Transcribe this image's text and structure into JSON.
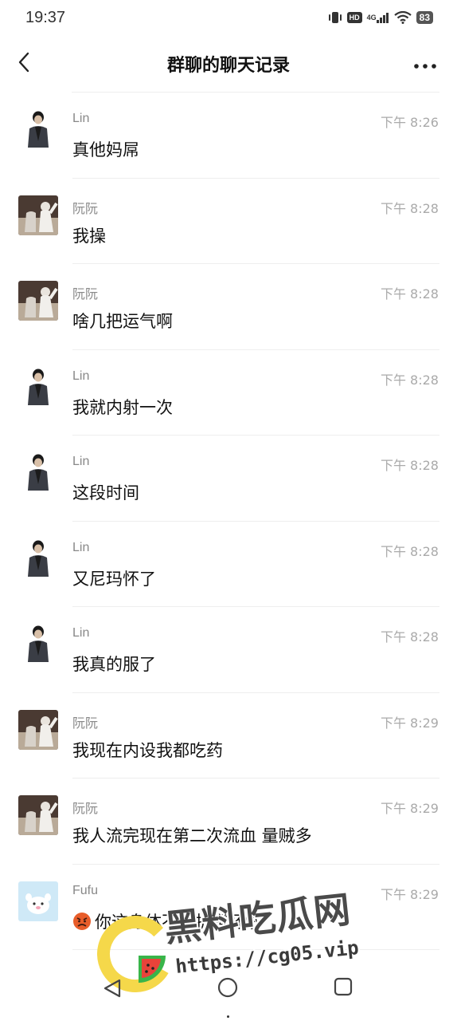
{
  "status_bar": {
    "time": "19:37",
    "hd_label": "HD",
    "network_label": "4G",
    "battery": "83",
    "icons": [
      "vibrate-icon",
      "hd-icon",
      "signal-icon",
      "wifi-icon",
      "battery-icon"
    ]
  },
  "header": {
    "title": "群聊的聊天记录",
    "back_icon": "chevron-left-icon",
    "more_icon": "more-horizontal-icon"
  },
  "messages": [
    {
      "sender": "Lin",
      "time": "下午 8:26",
      "text": "真他妈屌",
      "avatar": "lin"
    },
    {
      "sender": "阮阮",
      "time": "下午 8:28",
      "text": "我操",
      "avatar": "ruanruan"
    },
    {
      "sender": "阮阮",
      "time": "下午 8:28",
      "text": "啥几把运气啊",
      "avatar": "ruanruan"
    },
    {
      "sender": "Lin",
      "time": "下午 8:28",
      "text": "我就内射一次",
      "avatar": "lin"
    },
    {
      "sender": "Lin",
      "time": "下午 8:28",
      "text": "这段时间",
      "avatar": "lin"
    },
    {
      "sender": "Lin",
      "time": "下午 8:28",
      "text": "又尼玛怀了",
      "avatar": "lin"
    },
    {
      "sender": "Lin",
      "time": "下午 8:28",
      "text": "我真的服了",
      "avatar": "lin"
    },
    {
      "sender": "阮阮",
      "time": "下午 8:29",
      "text": "我现在内设我都吃药",
      "avatar": "ruanruan"
    },
    {
      "sender": "阮阮",
      "time": "下午 8:29",
      "text": "我人流完现在第二次流血 量贼多",
      "avatar": "ruanruan"
    },
    {
      "sender": "Fufu",
      "time": "下午 8:29",
      "text": "你这身体不饿折腾坏啦",
      "avatar": "fufu",
      "emoji": "angry-face-icon"
    }
  ],
  "watermark": {
    "title": "黑料吃瓜网",
    "url": "https://cg05.vip"
  },
  "nav_bar": {
    "icons": [
      "nav-back-icon",
      "nav-home-icon",
      "nav-recent-icon"
    ]
  }
}
